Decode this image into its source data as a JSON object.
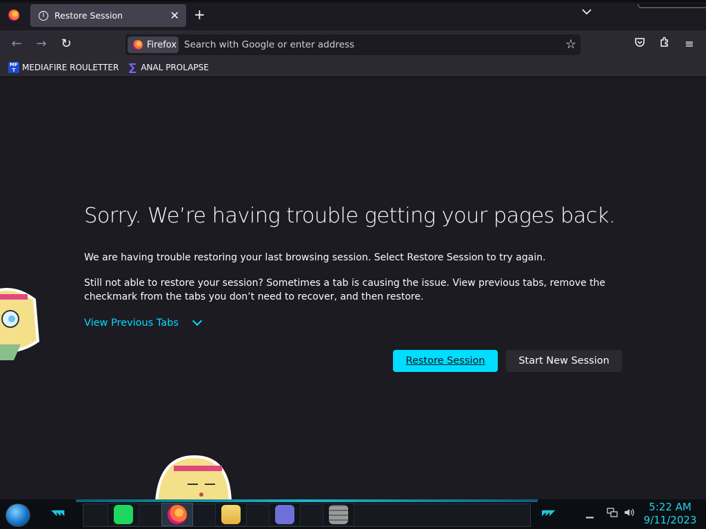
{
  "window": {
    "tab": {
      "title": "Restore Session",
      "close_glyph": "✕"
    },
    "new_tab_glyph": "+",
    "tab_list_glyph": "⌄"
  },
  "navbar": {
    "back_glyph": "←",
    "forward_glyph": "→",
    "reload_glyph": "↻",
    "identity_label": "Firefox",
    "address_placeholder": "Search with Google or enter address",
    "address_value": "",
    "bookmark_star_glyph": "☆",
    "pocket_glyph": "♡",
    "extensions_glyph": "⧉",
    "menu_glyph": "≡"
  },
  "bookmarks": [
    {
      "label": "MEDIAFIRE ROULETTER",
      "icon": "mediafire-icon",
      "fav_text": "MF T"
    },
    {
      "label": "ANAL PROLAPSE",
      "icon": "sigma-icon",
      "fav_text": "∑"
    }
  ],
  "content": {
    "heading": "Sorry. We’re having trouble getting your pages back.",
    "paragraph1": "We are having trouble restoring your last browsing session. Select Restore Session to try again.",
    "paragraph2": "Still not able to restore your session? Sometimes a tab is causing the issue. View previous tabs, remove the checkmark from the tabs you don’t need to recover, and then restore.",
    "view_previous_tabs": "View Previous Tabs",
    "restore_button": "Restore Session",
    "new_session_button": "Start New Session"
  },
  "colors": {
    "accent": "#00ddff",
    "page_bg": "#1c1b22",
    "toolbar_bg": "#2b2a33",
    "clock": "#22d3e8"
  },
  "taskbar": {
    "apps": [
      "spotify-icon",
      "firefox-icon",
      "file-explorer-icon",
      "card-app-icon",
      "brick-wall-icon"
    ],
    "clock_time": "5:22 AM",
    "clock_date": "9/11/2023"
  }
}
